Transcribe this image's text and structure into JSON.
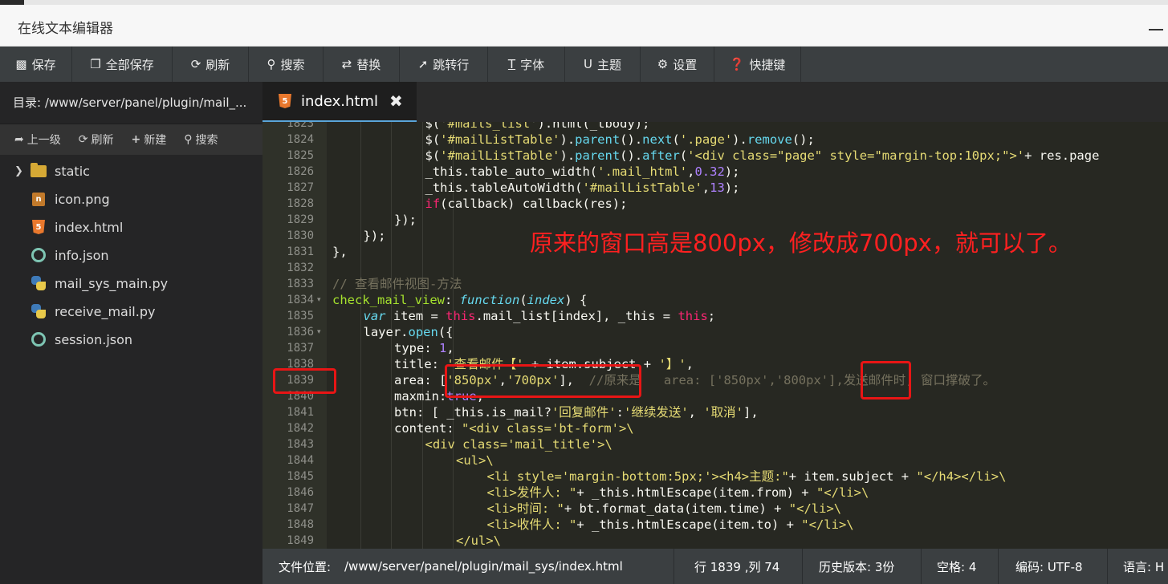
{
  "window": {
    "title": "在线文本编辑器"
  },
  "toolbar": [
    {
      "name": "save",
      "label": "保存",
      "icon": "save-icon"
    },
    {
      "name": "save-all",
      "label": "全部保存",
      "icon": "save-all-icon"
    },
    {
      "name": "refresh",
      "label": "刷新",
      "icon": "refresh-icon"
    },
    {
      "name": "search",
      "label": "搜索",
      "icon": "search-icon"
    },
    {
      "name": "replace",
      "label": "替换",
      "icon": "replace-icon"
    },
    {
      "name": "goto-line",
      "label": "跳转行",
      "icon": "goto-icon"
    },
    {
      "name": "font",
      "label": "字体",
      "icon": "font-icon"
    },
    {
      "name": "theme",
      "label": "主题",
      "icon": "theme-icon"
    },
    {
      "name": "settings",
      "label": "设置",
      "icon": "gear-icon"
    },
    {
      "name": "shortcuts",
      "label": "快捷键",
      "icon": "question-icon"
    }
  ],
  "sidebar": {
    "path": "目录: /www/server/panel/plugin/mail_...",
    "actions": {
      "up": "上一级",
      "refresh": "刷新",
      "new": "新建",
      "search": "搜索"
    },
    "files": [
      {
        "name": "static",
        "type": "folder"
      },
      {
        "name": "icon.png",
        "type": "image"
      },
      {
        "name": "index.html",
        "type": "html"
      },
      {
        "name": "info.json",
        "type": "json"
      },
      {
        "name": "mail_sys_main.py",
        "type": "python"
      },
      {
        "name": "receive_mail.py",
        "type": "python"
      },
      {
        "name": "session.json",
        "type": "json"
      }
    ]
  },
  "editor": {
    "tab_label": "index.html",
    "lines": [
      {
        "n": "1823",
        "fold": false,
        "ind": 3,
        "code": [
          [
            "$('",
            "p"
          ],
          [
            "#mails_list",
            "s"
          ],
          [
            "').html(_tbody);",
            "p"
          ]
        ]
      },
      {
        "n": "1824",
        "fold": false,
        "ind": 3,
        "code": [
          [
            "$(",
            "p"
          ],
          [
            "'#mailListTable'",
            "s"
          ],
          [
            ").",
            "p"
          ],
          [
            "parent",
            "b"
          ],
          [
            "().",
            "p"
          ],
          [
            "next",
            "b"
          ],
          [
            "(",
            "p"
          ],
          [
            "'.page'",
            "s"
          ],
          [
            ").",
            "p"
          ],
          [
            "remove",
            "b"
          ],
          [
            "();",
            "p"
          ]
        ]
      },
      {
        "n": "1825",
        "fold": false,
        "ind": 3,
        "code": [
          [
            "$(",
            "p"
          ],
          [
            "'#mailListTable'",
            "s"
          ],
          [
            ").",
            "p"
          ],
          [
            "parent",
            "b"
          ],
          [
            "().",
            "p"
          ],
          [
            "after",
            "b"
          ],
          [
            "(",
            "p"
          ],
          [
            "'<div class=\"page\" style=\"margin-top:10px;\">'",
            "s"
          ],
          [
            "+ res.page",
            "p"
          ]
        ]
      },
      {
        "n": "1826",
        "fold": false,
        "ind": 3,
        "code": [
          [
            "_this.table_auto_width(",
            "p"
          ],
          [
            "'.mail_html'",
            "s"
          ],
          [
            ",",
            "p"
          ],
          [
            "0.32",
            "n"
          ],
          [
            ");",
            "p"
          ]
        ]
      },
      {
        "n": "1827",
        "fold": false,
        "ind": 3,
        "code": [
          [
            "_this.tableAutoWidth(",
            "p"
          ],
          [
            "'#mailListTable'",
            "s"
          ],
          [
            ",",
            "p"
          ],
          [
            "13",
            "n"
          ],
          [
            ");",
            "p"
          ]
        ]
      },
      {
        "n": "1828",
        "fold": false,
        "ind": 3,
        "code": [
          [
            "if",
            "k"
          ],
          [
            "(callback) callback(res);",
            "p"
          ]
        ]
      },
      {
        "n": "1829",
        "fold": false,
        "ind": 2,
        "code": [
          [
            "});",
            "p"
          ]
        ]
      },
      {
        "n": "1830",
        "fold": false,
        "ind": 1,
        "code": [
          [
            "});",
            "p"
          ]
        ]
      },
      {
        "n": "1831",
        "fold": false,
        "ind": 0,
        "code": [
          [
            "},",
            "p"
          ]
        ]
      },
      {
        "n": "1832",
        "fold": false,
        "ind": 0,
        "code": []
      },
      {
        "n": "1833",
        "fold": false,
        "ind": 0,
        "code": [
          [
            "// 查看邮件视图-方法",
            "c"
          ]
        ]
      },
      {
        "n": "1834",
        "fold": true,
        "ind": 0,
        "code": [
          [
            "check_mail_view",
            "f"
          ],
          [
            ": ",
            "p"
          ],
          [
            "function",
            "t"
          ],
          [
            "(",
            "p"
          ],
          [
            "index",
            "t"
          ],
          [
            ") {",
            "p"
          ]
        ]
      },
      {
        "n": "1835",
        "fold": false,
        "ind": 1,
        "code": [
          [
            "var",
            "t"
          ],
          [
            " item = ",
            "p"
          ],
          [
            "this",
            "k"
          ],
          [
            ".mail_list[index], _this = ",
            "p"
          ],
          [
            "this",
            "k"
          ],
          [
            ";",
            "p"
          ]
        ]
      },
      {
        "n": "1836",
        "fold": true,
        "ind": 1,
        "code": [
          [
            "layer.",
            "p"
          ],
          [
            "open",
            "b"
          ],
          [
            "({",
            "p"
          ]
        ]
      },
      {
        "n": "1837",
        "fold": false,
        "ind": 2,
        "code": [
          [
            "type: ",
            "p"
          ],
          [
            "1",
            "n"
          ],
          [
            ",",
            "p"
          ]
        ]
      },
      {
        "n": "1838",
        "fold": false,
        "ind": 2,
        "code": [
          [
            "title: ",
            "p"
          ],
          [
            "'查看邮件【'",
            "s"
          ],
          [
            " + item.subject + ",
            "p"
          ],
          [
            "'】'",
            "s"
          ],
          [
            ",",
            "p"
          ]
        ]
      },
      {
        "n": "1839",
        "fold": false,
        "ind": 2,
        "code": [
          [
            "area: [",
            "p"
          ],
          [
            "'850px'",
            "s"
          ],
          [
            ",",
            "p"
          ],
          [
            "'700px'",
            "s"
          ],
          [
            "],  ",
            "p"
          ],
          [
            "//原来是   area: ['850px','800px'],发送邮件时, 窗口撑破了。",
            "c"
          ]
        ]
      },
      {
        "n": "1840",
        "fold": false,
        "ind": 2,
        "code": [
          [
            "maxmin:",
            "p"
          ],
          [
            "true",
            "n"
          ],
          [
            ",",
            "p"
          ]
        ]
      },
      {
        "n": "1841",
        "fold": false,
        "ind": 2,
        "code": [
          [
            "btn: [ _this.is_mail?",
            "p"
          ],
          [
            "'回复邮件'",
            "s"
          ],
          [
            ":",
            "p"
          ],
          [
            "'继续发送'",
            "s"
          ],
          [
            ", ",
            "p"
          ],
          [
            "'取消'",
            "s"
          ],
          [
            "],",
            "p"
          ]
        ]
      },
      {
        "n": "1842",
        "fold": false,
        "ind": 2,
        "code": [
          [
            "content: ",
            "p"
          ],
          [
            "\"<div class='bt-form'>\\",
            "s"
          ]
        ]
      },
      {
        "n": "1843",
        "fold": false,
        "ind": 3,
        "code": [
          [
            "<div class='mail_title'>\\",
            "s"
          ]
        ]
      },
      {
        "n": "1844",
        "fold": false,
        "ind": 4,
        "code": [
          [
            "<ul>\\",
            "s"
          ]
        ]
      },
      {
        "n": "1845",
        "fold": false,
        "ind": 5,
        "code": [
          [
            "<li style='margin-bottom:5px;'><h4>主题:\"",
            "s"
          ],
          [
            "+ item.subject + ",
            "p"
          ],
          [
            "\"</h4></li>\\",
            "s"
          ]
        ]
      },
      {
        "n": "1846",
        "fold": false,
        "ind": 5,
        "code": [
          [
            "<li>发件人: \"",
            "s"
          ],
          [
            "+ _this.htmlEscape(item.from) + ",
            "p"
          ],
          [
            "\"</li>\\",
            "s"
          ]
        ]
      },
      {
        "n": "1847",
        "fold": false,
        "ind": 5,
        "code": [
          [
            "<li>时间: \"",
            "s"
          ],
          [
            "+ bt.format_data(item.time) + ",
            "p"
          ],
          [
            "\"</li>\\",
            "s"
          ]
        ]
      },
      {
        "n": "1848",
        "fold": false,
        "ind": 5,
        "code": [
          [
            "<li>收件人: \"",
            "s"
          ],
          [
            "+ _this.htmlEscape(item.to) + ",
            "p"
          ],
          [
            "\"</li>\\",
            "s"
          ]
        ]
      },
      {
        "n": "1849",
        "fold": false,
        "ind": 4,
        "code": [
          [
            "</ul>\\",
            "s"
          ]
        ]
      }
    ]
  },
  "annotation": {
    "text": "原来的窗口高是800px，修改成700px，就可以了。"
  },
  "status": {
    "file_label": "文件位置:",
    "file_path": "/www/server/panel/plugin/mail_sys/index.html",
    "cursor": "行 1839 ,列 74",
    "history": "历史版本: 3份",
    "spaces": "空格: 4",
    "encoding": "编码: UTF-8",
    "language": "语言: H"
  },
  "colors": {
    "accent_red": "#e81515",
    "toolbar_bg": "#3b3f41",
    "editor_bg": "#272822"
  }
}
